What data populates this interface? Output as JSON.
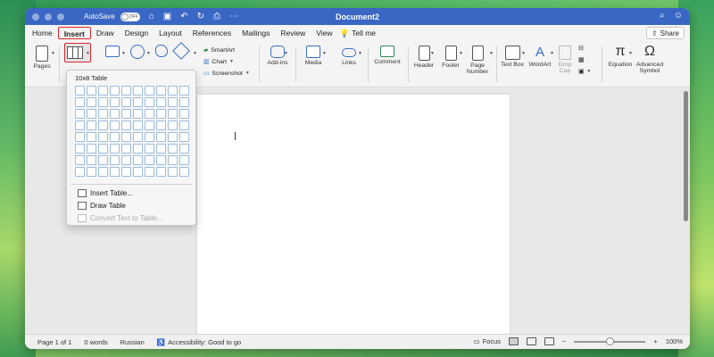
{
  "window": {
    "title": "Document2",
    "autosave_label": "AutoSave",
    "autosave_state": "OFF"
  },
  "tabs": [
    {
      "label": "Home",
      "active": false
    },
    {
      "label": "Insert",
      "active": true
    },
    {
      "label": "Draw",
      "active": false
    },
    {
      "label": "Design",
      "active": false
    },
    {
      "label": "Layout",
      "active": false
    },
    {
      "label": "References",
      "active": false
    },
    {
      "label": "Mailings",
      "active": false
    },
    {
      "label": "Review",
      "active": false
    },
    {
      "label": "View",
      "active": false
    }
  ],
  "tell_me": "Tell me",
  "share": "Share",
  "ribbon": {
    "pages": "Pages",
    "smartart": "SmartArt",
    "chart": "Chart",
    "screenshot": "Screenshot",
    "addins": "Add-ins",
    "media": "Media",
    "links": "Links",
    "comment": "Comment",
    "header": "Header",
    "footer": "Footer",
    "page_number_1": "Page",
    "page_number_2": "Number",
    "text_box": "Text Box",
    "wordart": "WordArt",
    "drop_cap_1": "Drop",
    "drop_cap_2": "Cap",
    "equation": "Equation",
    "advanced_symbol_1": "Advanced",
    "advanced_symbol_2": "Symbol"
  },
  "table_menu": {
    "header": "10x8 Table",
    "columns": 10,
    "rows": 8,
    "insert_table": "Insert Table...",
    "draw_table": "Draw Table",
    "convert_text": "Convert Text to Table..."
  },
  "status": {
    "page": "Page 1 of 1",
    "words": "0 words",
    "language": "Russian",
    "accessibility": "Accessibility: Good to go",
    "focus": "Focus",
    "zoom": "100%"
  },
  "colors": {
    "titlebar": "#3a66c4",
    "active_highlight": "#d9262b",
    "grid_cell": "#9cbcdc"
  }
}
